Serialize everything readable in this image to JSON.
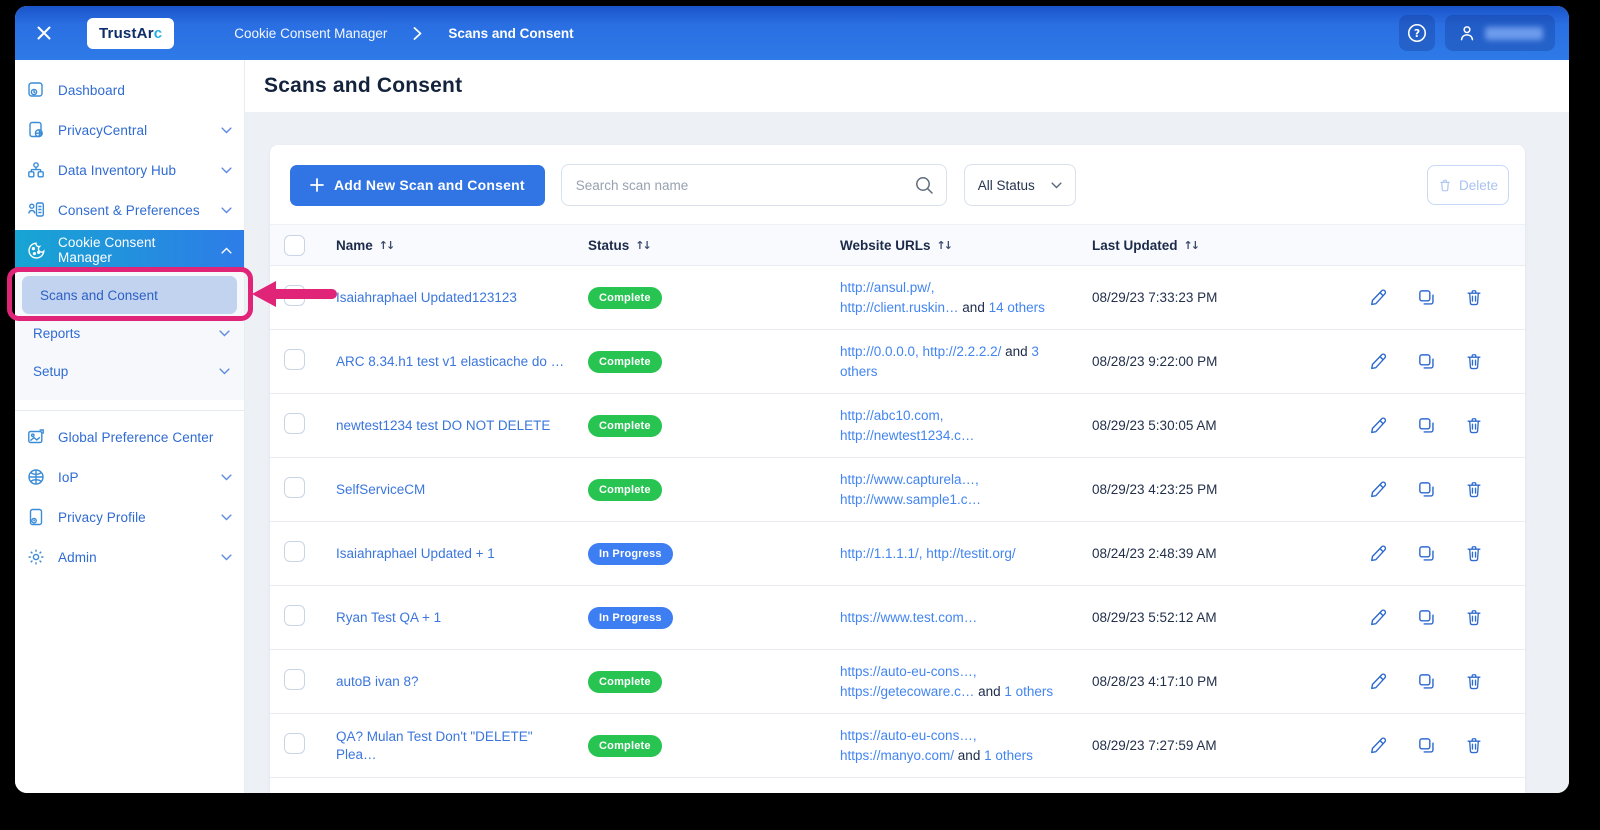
{
  "header": {
    "logo_prefix": "TrustAr",
    "logo_suffix": "c",
    "breadcrumb_app": "Cookie Consent Manager",
    "breadcrumb_page": "Scans and Consent"
  },
  "sidebar": {
    "items": [
      {
        "label": "Dashboard",
        "icon": "dashboard-icon",
        "expandable": false
      },
      {
        "label": "PrivacyCentral",
        "icon": "privacy-central-icon",
        "expandable": true
      },
      {
        "label": "Data Inventory Hub",
        "icon": "data-inventory-icon",
        "expandable": true
      },
      {
        "label": "Consent & Preferences",
        "icon": "consent-preferences-icon",
        "expandable": true
      },
      {
        "label": "Cookie Consent Manager",
        "icon": "cookie-icon",
        "expandable": true,
        "active": true,
        "expanded": true
      }
    ],
    "submenu": [
      {
        "label": "Scans and Consent",
        "selected": true
      },
      {
        "label": "Reports",
        "expandable": true
      },
      {
        "label": "Setup",
        "expandable": true
      }
    ],
    "items_bottom": [
      {
        "label": "Global Preference Center",
        "icon": "image-icon",
        "expandable": false
      },
      {
        "label": "IoP",
        "icon": "globe-icon",
        "expandable": true
      },
      {
        "label": "Privacy Profile",
        "icon": "profile-doc-icon",
        "expandable": true
      },
      {
        "label": "Admin",
        "icon": "gear-icon",
        "expandable": true
      }
    ]
  },
  "main": {
    "title": "Scans and Consent",
    "toolbar": {
      "add_button": "Add New Scan and Consent",
      "search_placeholder": "Search scan name",
      "status_filter": "All Status",
      "delete_button": "Delete"
    },
    "table": {
      "columns": [
        "Name",
        "Status",
        "Website URLs",
        "Last Updated"
      ],
      "rows": [
        {
          "name": "Isaiahraphael Updated123123",
          "status": "Complete",
          "status_type": "complete",
          "url_segments": [
            {
              "text": "http://ansul.pw/,",
              "link": true
            },
            {
              "br": true
            },
            {
              "text": "http://client.ruskin…",
              "link": true
            },
            {
              "text": " and ",
              "link": false
            },
            {
              "text": "14 others",
              "link": true
            }
          ],
          "updated": "08/29/23 7:33:23 PM"
        },
        {
          "name": "ARC 8.34.h1 test v1 elasticache do …",
          "status": "Complete",
          "status_type": "complete",
          "url_segments": [
            {
              "text": "http://0.0.0.0, http://2.2.2.2/",
              "link": true
            },
            {
              "text": " and ",
              "link": false
            },
            {
              "text": "3 others",
              "link": true
            }
          ],
          "updated": "08/28/23 9:22:00 PM"
        },
        {
          "name": "newtest1234 test DO NOT DELETE",
          "status": "Complete",
          "status_type": "complete",
          "url_segments": [
            {
              "text": "http://abc10.com,",
              "link": true
            },
            {
              "br": true
            },
            {
              "text": "http://newtest1234.c…",
              "link": true
            }
          ],
          "updated": "08/29/23 5:30:05 AM"
        },
        {
          "name": "SelfServiceCM",
          "status": "Complete",
          "status_type": "complete",
          "url_segments": [
            {
              "text": "http://www.capturela…,",
              "link": true
            },
            {
              "br": true
            },
            {
              "text": "http://www.sample1.c…",
              "link": true
            }
          ],
          "updated": "08/29/23 4:23:25 PM"
        },
        {
          "name": "Isaiahraphael Updated + 1",
          "status": "In Progress",
          "status_type": "in_progress",
          "url_segments": [
            {
              "text": "http://1.1.1.1/, http://testit.org/",
              "link": true
            }
          ],
          "updated": "08/24/23 2:48:39 AM"
        },
        {
          "name": "Ryan Test QA + 1",
          "status": "In Progress",
          "status_type": "in_progress",
          "url_segments": [
            {
              "text": "https://www.test.com…",
              "link": true
            }
          ],
          "updated": "08/29/23 5:52:12 AM"
        },
        {
          "name": "autoB ivan 8?",
          "status": "Complete",
          "status_type": "complete",
          "url_segments": [
            {
              "text": "https://auto-eu-cons…,",
              "link": true
            },
            {
              "br": true
            },
            {
              "text": "https://getecoware.c…",
              "link": true
            },
            {
              "text": " and ",
              "link": false
            },
            {
              "text": "1 others",
              "link": true
            }
          ],
          "updated": "08/28/23 4:17:10 PM"
        },
        {
          "name": "QA? Mulan Test Don't \"DELETE\" Plea…",
          "status": "Complete",
          "status_type": "complete",
          "url_segments": [
            {
              "text": "https://auto-eu-cons…,",
              "link": true
            },
            {
              "br": true
            },
            {
              "text": "https://manyo.com/",
              "link": true
            },
            {
              "text": " and ",
              "link": false
            },
            {
              "text": "1 others",
              "link": true
            }
          ],
          "updated": "08/29/23 7:27:59 AM"
        }
      ]
    }
  },
  "annotation": {
    "highlight_target": "Scans and Consent",
    "color": "#e02478"
  },
  "colors": {
    "header_blue": "#2a6fe2",
    "active_item_gradient": [
      "#17a5d3",
      "#2e7ce8"
    ],
    "selected_subitem_bg": "#c2d3f0",
    "badge_complete": "#28c452",
    "badge_in_progress": "#3d7ef2",
    "link_blue": "#4285f0",
    "primary_button": "#3174e3",
    "highlight_pink": "#e02478"
  }
}
